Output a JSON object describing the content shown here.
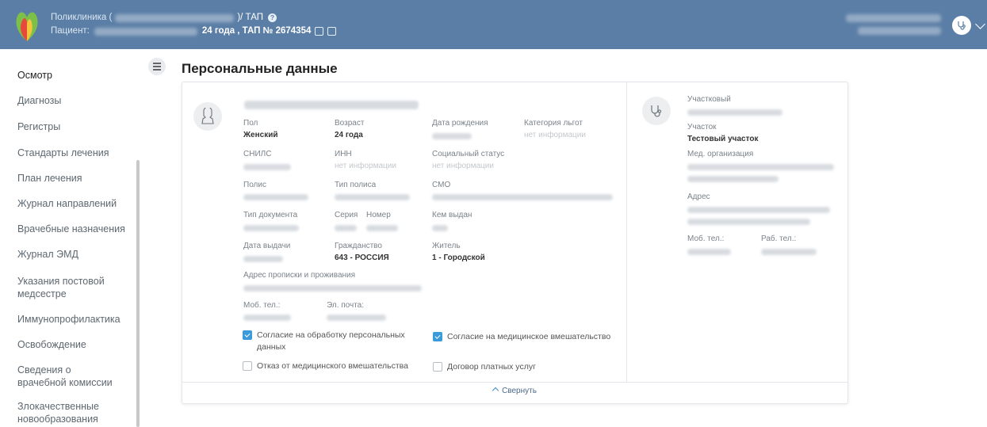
{
  "header": {
    "clinic_label": "Поликлиника (",
    "tap_label": ")/ ТАП",
    "patient_label": "Пациент:",
    "patient_info": "24 года , ТАП № 2674354"
  },
  "sidebar": {
    "items": [
      {
        "label": "Осмотр"
      },
      {
        "label": "Диагнозы"
      },
      {
        "label": "Регистры"
      },
      {
        "label": "Стандарты лечения"
      },
      {
        "label": "План лечения"
      },
      {
        "label": "Журнал направлений"
      },
      {
        "label": "Врачебные назначения"
      },
      {
        "label": "Журнал ЭМД"
      },
      {
        "label": "Указания постовой медсестре"
      },
      {
        "label": "Иммунопрофилактика"
      },
      {
        "label": "Освобождение"
      },
      {
        "label": "Сведения о врачебной комиссии"
      },
      {
        "label": "Злокачественные новообразования"
      }
    ]
  },
  "page": {
    "title": "Персональные данные"
  },
  "personal": {
    "gender_label": "Пол",
    "gender": "Женский",
    "age_label": "Возраст",
    "age": "24 года",
    "birth_label": "Дата рождения",
    "benefit_label": "Категория льгот",
    "benefit": "нет информации",
    "snils_label": "СНИЛС",
    "inn_label": "ИНН",
    "inn": "нет информации",
    "social_label": "Социальный статус",
    "social": "нет информации",
    "policy_label": "Полис",
    "policy_type_label": "Тип полиса",
    "smo_label": "СМО",
    "doc_type_label": "Тип документа",
    "series_label": "Серия",
    "number_label": "Номер",
    "issued_by_label": "Кем выдан",
    "issue_date_label": "Дата выдачи",
    "citizenship_label": "Гражданство",
    "citizenship": "643 - РОССИЯ",
    "resident_label": "Житель",
    "resident": "1 - Городской",
    "address_label": "Адрес прописки и проживания",
    "mobile_label": "Моб. тел.:",
    "email_label": "Эл. почта:",
    "consent_personal": "Согласие на обработку персональных данных",
    "consent_medical": "Согласие на медицинское вмешательство",
    "refusal_medical": "Отказ от медицинского вмешательства",
    "paid_contract": "Договор платных услуг"
  },
  "checkboxes": {
    "consent_personal": true,
    "consent_medical": true,
    "refusal_medical": false,
    "paid_contract": false
  },
  "district": {
    "doctor_label": "Участковый",
    "area_label": "Участок",
    "area": "Тестовый участок",
    "org_label": "Мед. организация",
    "address_label": "Адрес",
    "mobile_label": "Моб. тел.:",
    "work_label": "Раб. тел.:"
  },
  "collapse_label": "Свернуть",
  "colors": {
    "header_bg": "#5b7ea6",
    "accent": "#3b9ad9"
  }
}
